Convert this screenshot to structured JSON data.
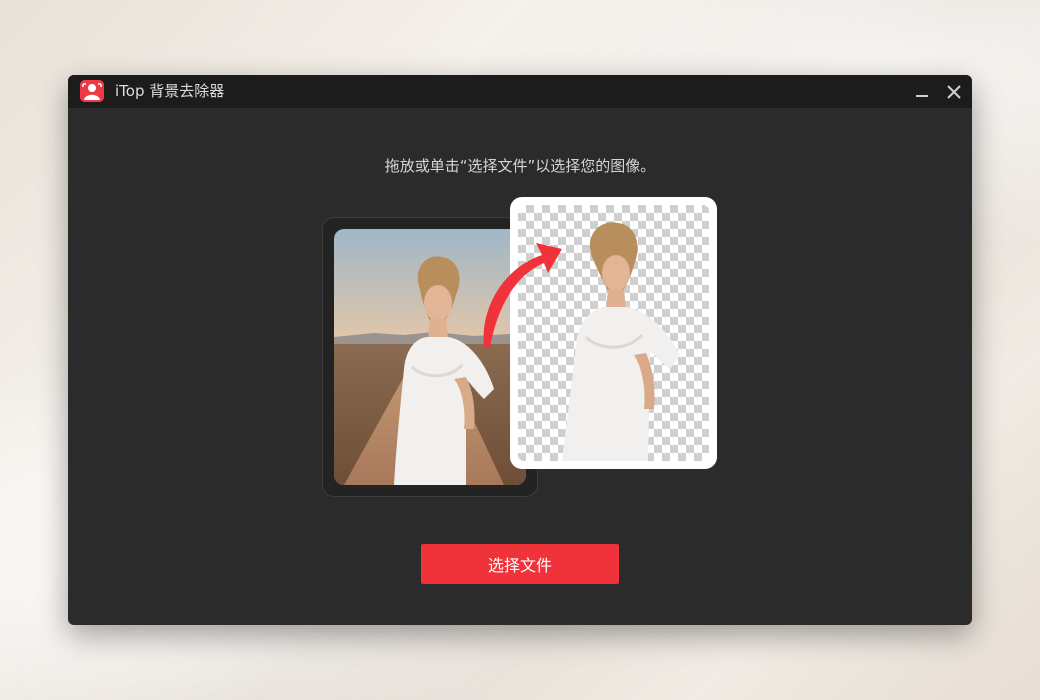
{
  "app": {
    "title": "iTop 背景去除器",
    "icon": "user-portrait-icon",
    "accent_color": "#f0323a"
  },
  "window_controls": {
    "minimize_icon": "minimize-icon",
    "close_icon": "close-icon"
  },
  "main": {
    "instruction": "拖放或单击“选择文件”以选择您的图像。",
    "select_file_label": "选择文件",
    "before_image": "woman-in-white-dress-on-desert-road",
    "after_image": "woman-cutout-on-transparent-checkerboard",
    "arrow_icon": "curved-arrow-icon"
  }
}
